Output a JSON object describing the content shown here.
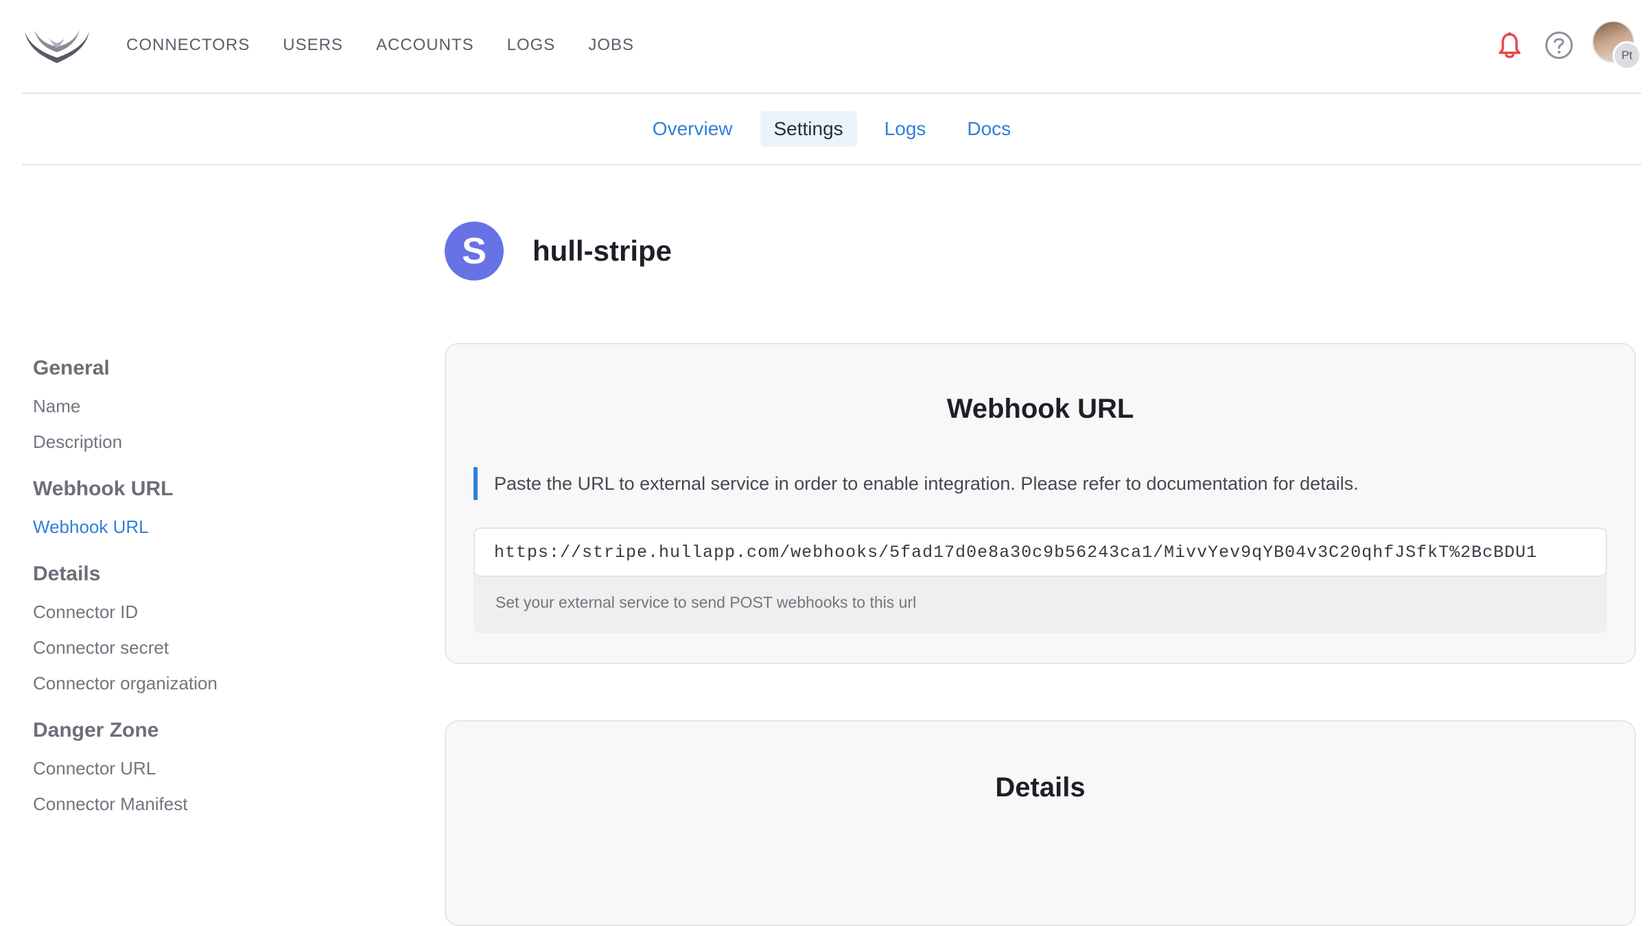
{
  "nav": {
    "logo_icon": "hull-wings-logo",
    "items": [
      "CONNECTORS",
      "USERS",
      "ACCOUNTS",
      "LOGS",
      "JOBS"
    ],
    "bell_icon": "bell-icon",
    "help_icon": "help-icon",
    "avatar_badge": "Pt",
    "colors": {
      "bell": "#e5484d",
      "link": "#2f80d9"
    }
  },
  "tabs": {
    "items": [
      "Overview",
      "Settings",
      "Logs",
      "Docs"
    ],
    "active": "Settings"
  },
  "connector": {
    "logo_letter": "S",
    "logo_color": "#6772e5",
    "name": "hull-stripe"
  },
  "sidebar": {
    "sections": [
      {
        "heading": "General",
        "items": [
          "Name",
          "Description"
        ]
      },
      {
        "heading": "Webhook URL",
        "items": [
          "Webhook URL"
        ]
      },
      {
        "heading": "Details",
        "items": [
          "Connector ID",
          "Connector secret",
          "Connector organization"
        ]
      },
      {
        "heading": "Danger Zone",
        "items": [
          "Connector URL",
          "Connector Manifest"
        ]
      }
    ],
    "active_item": "Webhook URL"
  },
  "webhook_card": {
    "title": "Webhook URL",
    "callout": "Paste the URL to external service in order to enable integration. Please refer to documentation for details.",
    "url_value": "https://stripe.hullapp.com/webhooks/5fad17d0e8a30c9b56243ca1/MivvYev9qYB04v3C20qhfJSfkT%2BcBDU1",
    "hint": "Set your external service to send POST webhooks to this url"
  },
  "details_card": {
    "title": "Details"
  }
}
